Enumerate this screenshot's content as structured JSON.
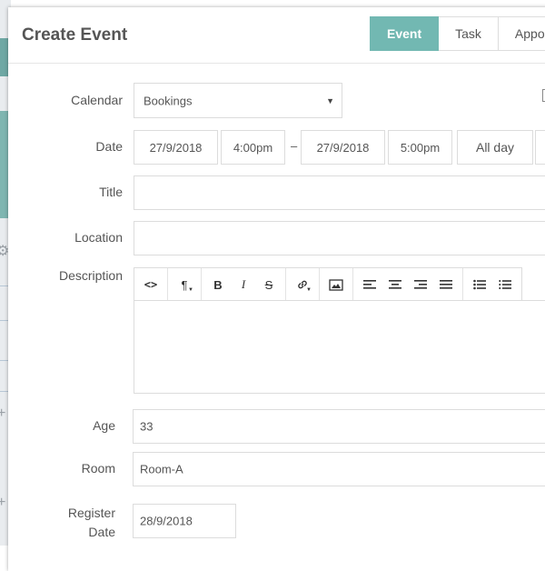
{
  "modal": {
    "title": "Create Event",
    "tabs": [
      {
        "label": "Event",
        "active": true
      },
      {
        "label": "Task",
        "active": false
      },
      {
        "label": "Appoi",
        "active": false
      }
    ]
  },
  "form": {
    "calendar": {
      "label": "Calendar",
      "value": "Bookings"
    },
    "date": {
      "label": "Date",
      "start_date": "27/9/2018",
      "start_time": "4:00pm",
      "separator": "–",
      "end_date": "27/9/2018",
      "end_time": "5:00pm",
      "all_day_label": "All day"
    },
    "title": {
      "label": "Title",
      "value": ""
    },
    "location": {
      "label": "Location",
      "value": ""
    },
    "description": {
      "label": "Description",
      "value": ""
    },
    "age": {
      "label": "Age",
      "value": "33"
    },
    "room": {
      "label": "Room",
      "value": "Room-A"
    },
    "register_date": {
      "label_line1": "Register",
      "label_line2": "Date",
      "value": "28/9/2018"
    }
  },
  "toolbar": {
    "code": "<>",
    "paragraph": "¶",
    "bold": "B",
    "italic": "I",
    "strike": "S"
  },
  "colors": {
    "accent": "#72b8b2",
    "border": "#dcdcdc",
    "text": "#555555"
  }
}
